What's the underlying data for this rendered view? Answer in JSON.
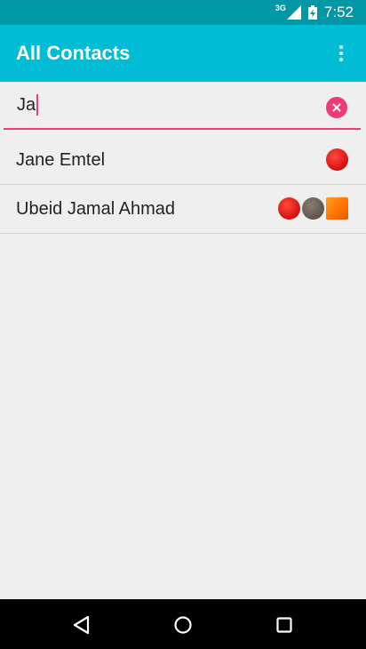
{
  "status_bar": {
    "network": "3G",
    "time": "7:52"
  },
  "app_bar": {
    "title": "All Contacts",
    "menu_icon": "overflow-menu-icon"
  },
  "search": {
    "value": "Ja",
    "clear_icon": "clear-icon"
  },
  "contacts": [
    {
      "name": "Jane Emtel",
      "badges": [
        {
          "shape": "circle",
          "color": "#e21e1e"
        }
      ]
    },
    {
      "name": "Ubeid Jamal Ahmad",
      "badges": [
        {
          "shape": "circle",
          "color": "#e21e1e"
        },
        {
          "shape": "circle",
          "color": "#6e6259"
        },
        {
          "shape": "square",
          "color": "#ff7a00"
        }
      ]
    }
  ],
  "nav_bar": {
    "back_icon": "back-icon",
    "home_icon": "home-icon",
    "recents_icon": "recents-icon"
  },
  "colors": {
    "status_bar": "#0097a7",
    "app_bar": "#00bcd4",
    "accent": "#e63f7a",
    "background": "#f0eff0"
  }
}
